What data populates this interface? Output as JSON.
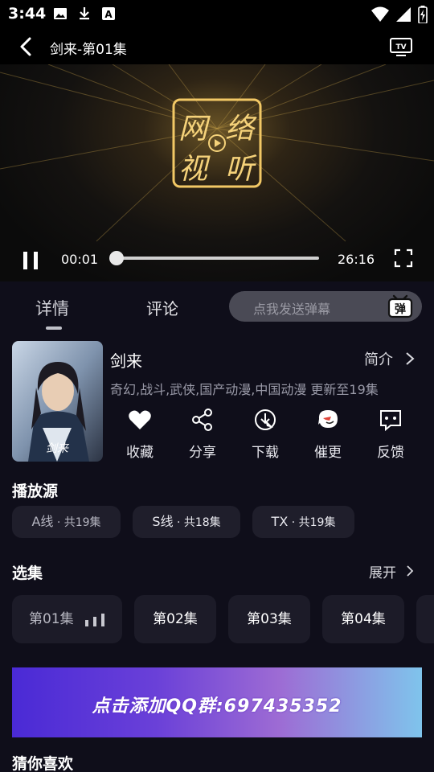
{
  "status": {
    "time": "3:44"
  },
  "header": {
    "title": "剑来-第01集"
  },
  "player": {
    "current_time": "00:01",
    "total_time": "26:16",
    "progress": 0.0,
    "logo_chars": [
      "网",
      "络",
      "视",
      "听"
    ]
  },
  "tabs": [
    {
      "label": "详情",
      "active": true
    },
    {
      "label": "评论",
      "active": false
    }
  ],
  "danmu": {
    "placeholder": "点我发送弹幕",
    "icon_label": "弹"
  },
  "show": {
    "title": "剑来",
    "intro_label": "简介",
    "tags": "奇幻,战斗,武侠,国产动漫,中国动漫 更新至19集",
    "cover_text": "剑来"
  },
  "actions": [
    {
      "label": "收藏",
      "icon": "heart-icon"
    },
    {
      "label": "分享",
      "icon": "share-icon"
    },
    {
      "label": "下载",
      "icon": "download-icon"
    },
    {
      "label": "催更",
      "icon": "urge-icon"
    },
    {
      "label": "反馈",
      "icon": "feedback-icon"
    }
  ],
  "sources": {
    "title": "播放源",
    "items": [
      {
        "name": "A线",
        "count": " · 共19集"
      },
      {
        "name": "S线",
        "count": " · 共18集"
      },
      {
        "name": "TX",
        "count": " · 共19集"
      }
    ]
  },
  "episodes": {
    "title": "选集",
    "expand_label": "展开",
    "items": [
      "第01集",
      "第02集",
      "第03集",
      "第04集"
    ],
    "current_index": 0
  },
  "banner": {
    "text": "点击添加QQ群:697435352"
  },
  "recommend": {
    "title": "猜你喜欢"
  },
  "colors": {
    "background": "#0f0e1a",
    "chip": "#1f1e2b",
    "accent_gold": "#f0c050"
  }
}
